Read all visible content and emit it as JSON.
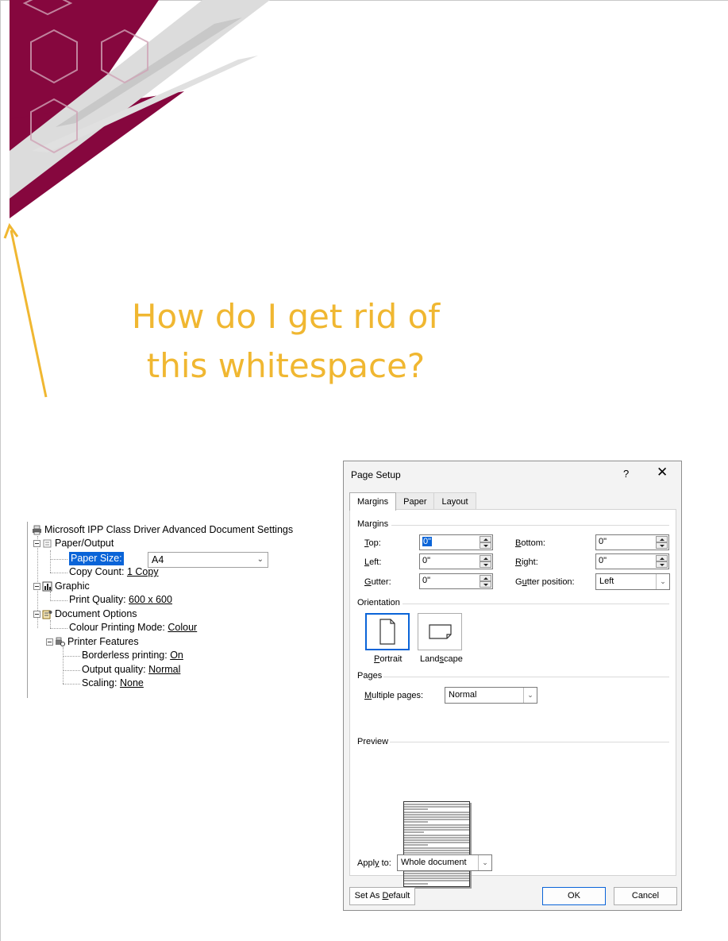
{
  "colors": {
    "accent_maroon": "#86073e",
    "question_yellow": "#f0b731",
    "selection_blue": "#0a64d8"
  },
  "question": {
    "line1": "How do I get rid of",
    "line2": "this whitespace?"
  },
  "tree": {
    "root": "Microsoft IPP Class Driver Advanced Document Settings",
    "paper_output": "Paper/Output",
    "paper_size_label": "Paper Size:",
    "paper_size_value": "A4",
    "copy_count_label": "Copy Count:",
    "copy_count_value": "1 Copy",
    "graphic": "Graphic",
    "print_quality_label": "Print Quality:",
    "print_quality_value": "600 x 600",
    "document_options": "Document Options",
    "colour_mode_label": "Colour Printing Mode:",
    "colour_mode_value": "Colour",
    "printer_features": "Printer Features",
    "borderless_label": "Borderless printing:",
    "borderless_value": "On",
    "output_quality_label": "Output quality:",
    "output_quality_value": "Normal",
    "scaling_label": "Scaling:",
    "scaling_value": "None"
  },
  "dialog": {
    "title": "Page Setup",
    "help": "?",
    "close": "✕",
    "tabs": [
      "Margins",
      "Paper",
      "Layout"
    ],
    "margins_group": "Margins",
    "top_label_u": "T",
    "top_label_rest": "op:",
    "top_value": "0\"",
    "left_label_u": "L",
    "left_label_rest": "eft:",
    "left_value": "0\"",
    "gutter_label_u": "G",
    "gutter_label_rest": "utter:",
    "gutter_value": "0\"",
    "bottom_label_u": "B",
    "bottom_label_rest": "ottom:",
    "bottom_value": "0\"",
    "right_label_u": "R",
    "right_label_rest": "ight:",
    "right_value": "0\"",
    "gutter_pos_label_a": "G",
    "gutter_pos_label_u": "u",
    "gutter_pos_label_rest": "tter position:",
    "gutter_pos_value": "Left",
    "orientation_group": "Orientation",
    "portrait_u": "P",
    "portrait_rest": "ortrait",
    "landscape_a": "Land",
    "landscape_u": "s",
    "landscape_rest": "cape",
    "pages_group": "Pages",
    "multiple_pages_u": "M",
    "multiple_pages_rest": "ultiple pages:",
    "multiple_pages_value": "Normal",
    "preview_group": "Preview",
    "apply_to_a": "Appl",
    "apply_to_u": "y",
    "apply_to_rest": " to:",
    "apply_to_value": "Whole document",
    "set_default_a": "Set As ",
    "set_default_u": "D",
    "set_default_rest": "efault",
    "ok": "OK",
    "cancel": "Cancel"
  }
}
